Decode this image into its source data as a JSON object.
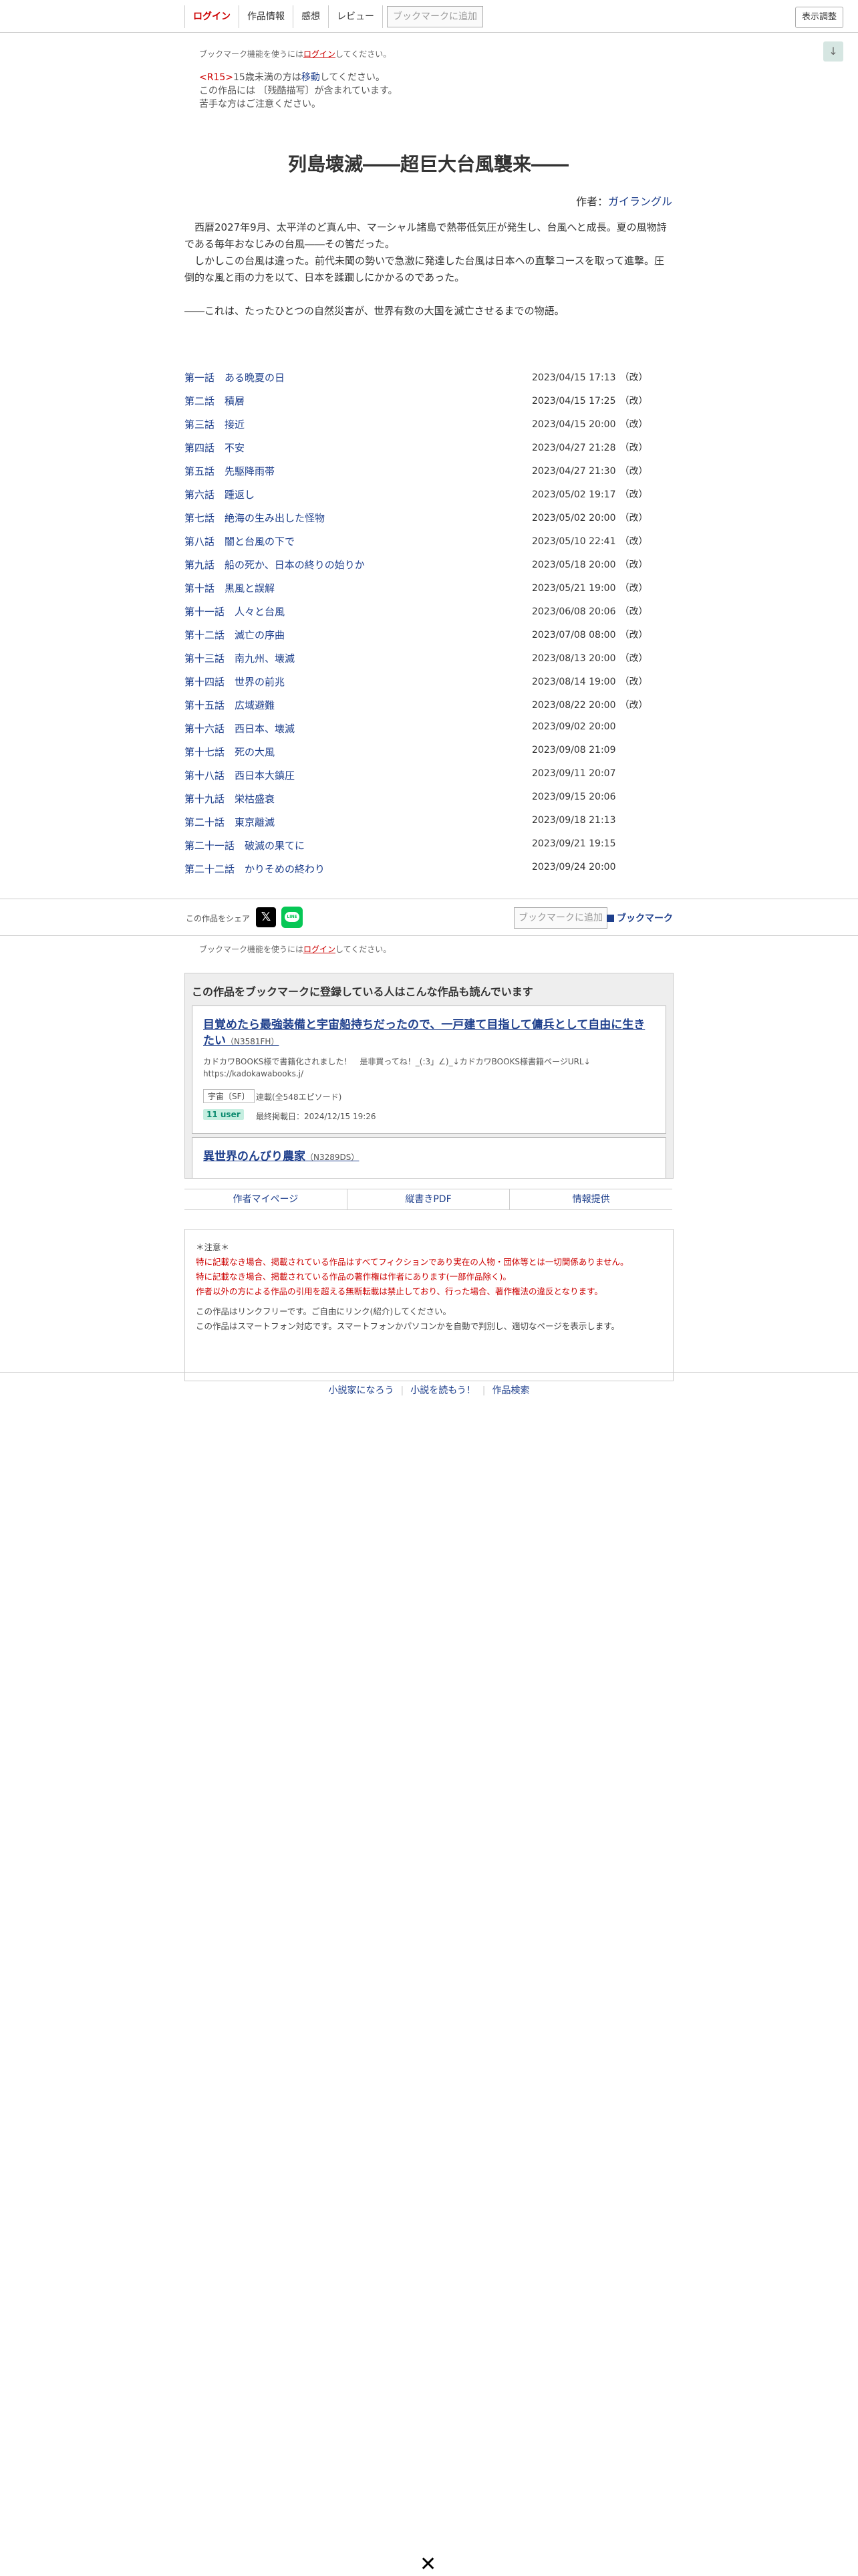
{
  "header": {
    "tabs": [
      "ログイン",
      "作品情報",
      "感想",
      "レビュー"
    ],
    "bookmark_add": "ブックマークに追加",
    "display_settings": "表示調整",
    "scroll_arrow": "↓"
  },
  "bookmark_note": {
    "prefix": "ブックマーク機能を使うには",
    "link": "ログイン",
    "suffix": "してください。"
  },
  "warning": {
    "r15": "<R15>",
    "line1_mid": "15歳未満の方は",
    "move": "移動",
    "line1_end": "してください。",
    "line2": "この作品には 〔残酷描写〕が含まれています。",
    "line3": "苦手な方はご注意ください。"
  },
  "novel": {
    "title": "列島壊滅――超巨大台風襲来――",
    "author_label": "作者：",
    "author": "ガイラングル",
    "synopsis": [
      "　西暦2027年9月、太平洋のど真ん中、マーシャル諸島で熱帯低気圧が発生し、台風へと成長。夏の風物詩である毎年おなじみの台風――その筈だった。",
      "　しかしこの台風は違った。前代未聞の勢いで急激に発達した台風は日本への直撃コースを取って進撃。圧倒的な風と雨の力を以て、日本を蹂躙しにかかるのであった。",
      "",
      "――これは、たったひとつの自然災害が、世界有数の大国を滅亡させるまでの物語。"
    ]
  },
  "chapters": [
    {
      "title": "第一話　ある晩夏の日",
      "date": "2023/04/15 17:13",
      "rev": "（改）"
    },
    {
      "title": "第二話　積層",
      "date": "2023/04/15 17:25",
      "rev": "（改）"
    },
    {
      "title": "第三話　接近",
      "date": "2023/04/15 20:00",
      "rev": "（改）"
    },
    {
      "title": "第四話　不安",
      "date": "2023/04/27 21:28",
      "rev": "（改）"
    },
    {
      "title": "第五話　先駆降雨帯",
      "date": "2023/04/27 21:30",
      "rev": "（改）"
    },
    {
      "title": "第六話　踵返し",
      "date": "2023/05/02 19:17",
      "rev": "（改）"
    },
    {
      "title": "第七話　絶海の生み出した怪物",
      "date": "2023/05/02 20:00",
      "rev": "（改）"
    },
    {
      "title": "第八話　闇と台風の下で",
      "date": "2023/05/10 22:41",
      "rev": "（改）"
    },
    {
      "title": "第九話　船の死か、日本の終りの始りか",
      "date": "2023/05/18 20:00",
      "rev": "（改）"
    },
    {
      "title": "第十話　黒風と誤解",
      "date": "2023/05/21 19:00",
      "rev": "（改）"
    },
    {
      "title": "第十一話　人々と台風",
      "date": "2023/06/08 20:06",
      "rev": "（改）"
    },
    {
      "title": "第十二話　滅亡の序曲",
      "date": "2023/07/08 08:00",
      "rev": "（改）"
    },
    {
      "title": "第十三話　南九州、壊滅",
      "date": "2023/08/13 20:00",
      "rev": "（改）"
    },
    {
      "title": "第十四話　世界の前兆",
      "date": "2023/08/14 19:00",
      "rev": "（改）"
    },
    {
      "title": "第十五話　広域避難",
      "date": "2023/08/22 20:00",
      "rev": "（改）"
    },
    {
      "title": "第十六話　西日本、壊滅",
      "date": "2023/09/02 20:00",
      "rev": ""
    },
    {
      "title": "第十七話　死の大風",
      "date": "2023/09/08 21:09",
      "rev": ""
    },
    {
      "title": "第十八話　西日本大鎮圧",
      "date": "2023/09/11 20:07",
      "rev": ""
    },
    {
      "title": "第十九話　栄枯盛衰",
      "date": "2023/09/15 20:06",
      "rev": ""
    },
    {
      "title": "第二十話　東京離滅",
      "date": "2023/09/18 21:13",
      "rev": ""
    },
    {
      "title": "第二十一話　破滅の果てに",
      "date": "2023/09/21 19:15",
      "rev": ""
    },
    {
      "title": "第二十二話　かりそめの終わり",
      "date": "2023/09/24 20:00",
      "rev": ""
    }
  ],
  "share": {
    "label": "この作品をシェア",
    "x": "𝕏",
    "line": "LINE",
    "bookmark_add": "ブックマークに追加",
    "bookmark": "ブックマーク"
  },
  "recommend": {
    "heading": "この作品をブックマークに登録している人はこんな作品も読んでいます",
    "cards": [
      {
        "title": "目覚めたら最強装備と宇宙船持ちだったので、一戸建て目指して傭兵として自由に生きたい",
        "ncode": "（N3581FH）",
        "desc": "カドカワBOOKS様で書籍化されました！　是非買ってね！_(:3」∠)_↓カドカワBOOKS様書籍ページURL↓ https://kadokawabooks.j/",
        "tag": "宇宙〔SF〕",
        "episodes": "連載(全548エピソード)",
        "users": "11 user",
        "updated": "最終掲載日：2024/12/15 19:26"
      },
      {
        "title": "異世界のんびり農家",
        "ncode": "（N3289DS）"
      }
    ]
  },
  "links": [
    "作者マイページ",
    "縦書きPDF",
    "情報提供"
  ],
  "notice": {
    "head": "＊注意＊",
    "red1": "特に記載なき場合、掲載されている作品はすべてフィクションであり実在の人物・団体等とは一切関係ありません。",
    "red2": "特に記載なき場合、掲載されている作品の著作権は作者にあります(一部作品除く)。",
    "red3": "作者以外の方による作品の引用を超える無断転載は禁止しており、行った場合、著作権法の違反となります。",
    "p1": "この作品はリンクフリーです。ご自由にリンク(紹介)してください。",
    "p2": "この作品はスマートフォン対応です。スマートフォンかパソコンかを自動で判別し、適切なページを表示します。"
  },
  "footer": [
    "小説家になろう",
    "小説を読もう！",
    "作品検索"
  ],
  "close": "✕"
}
